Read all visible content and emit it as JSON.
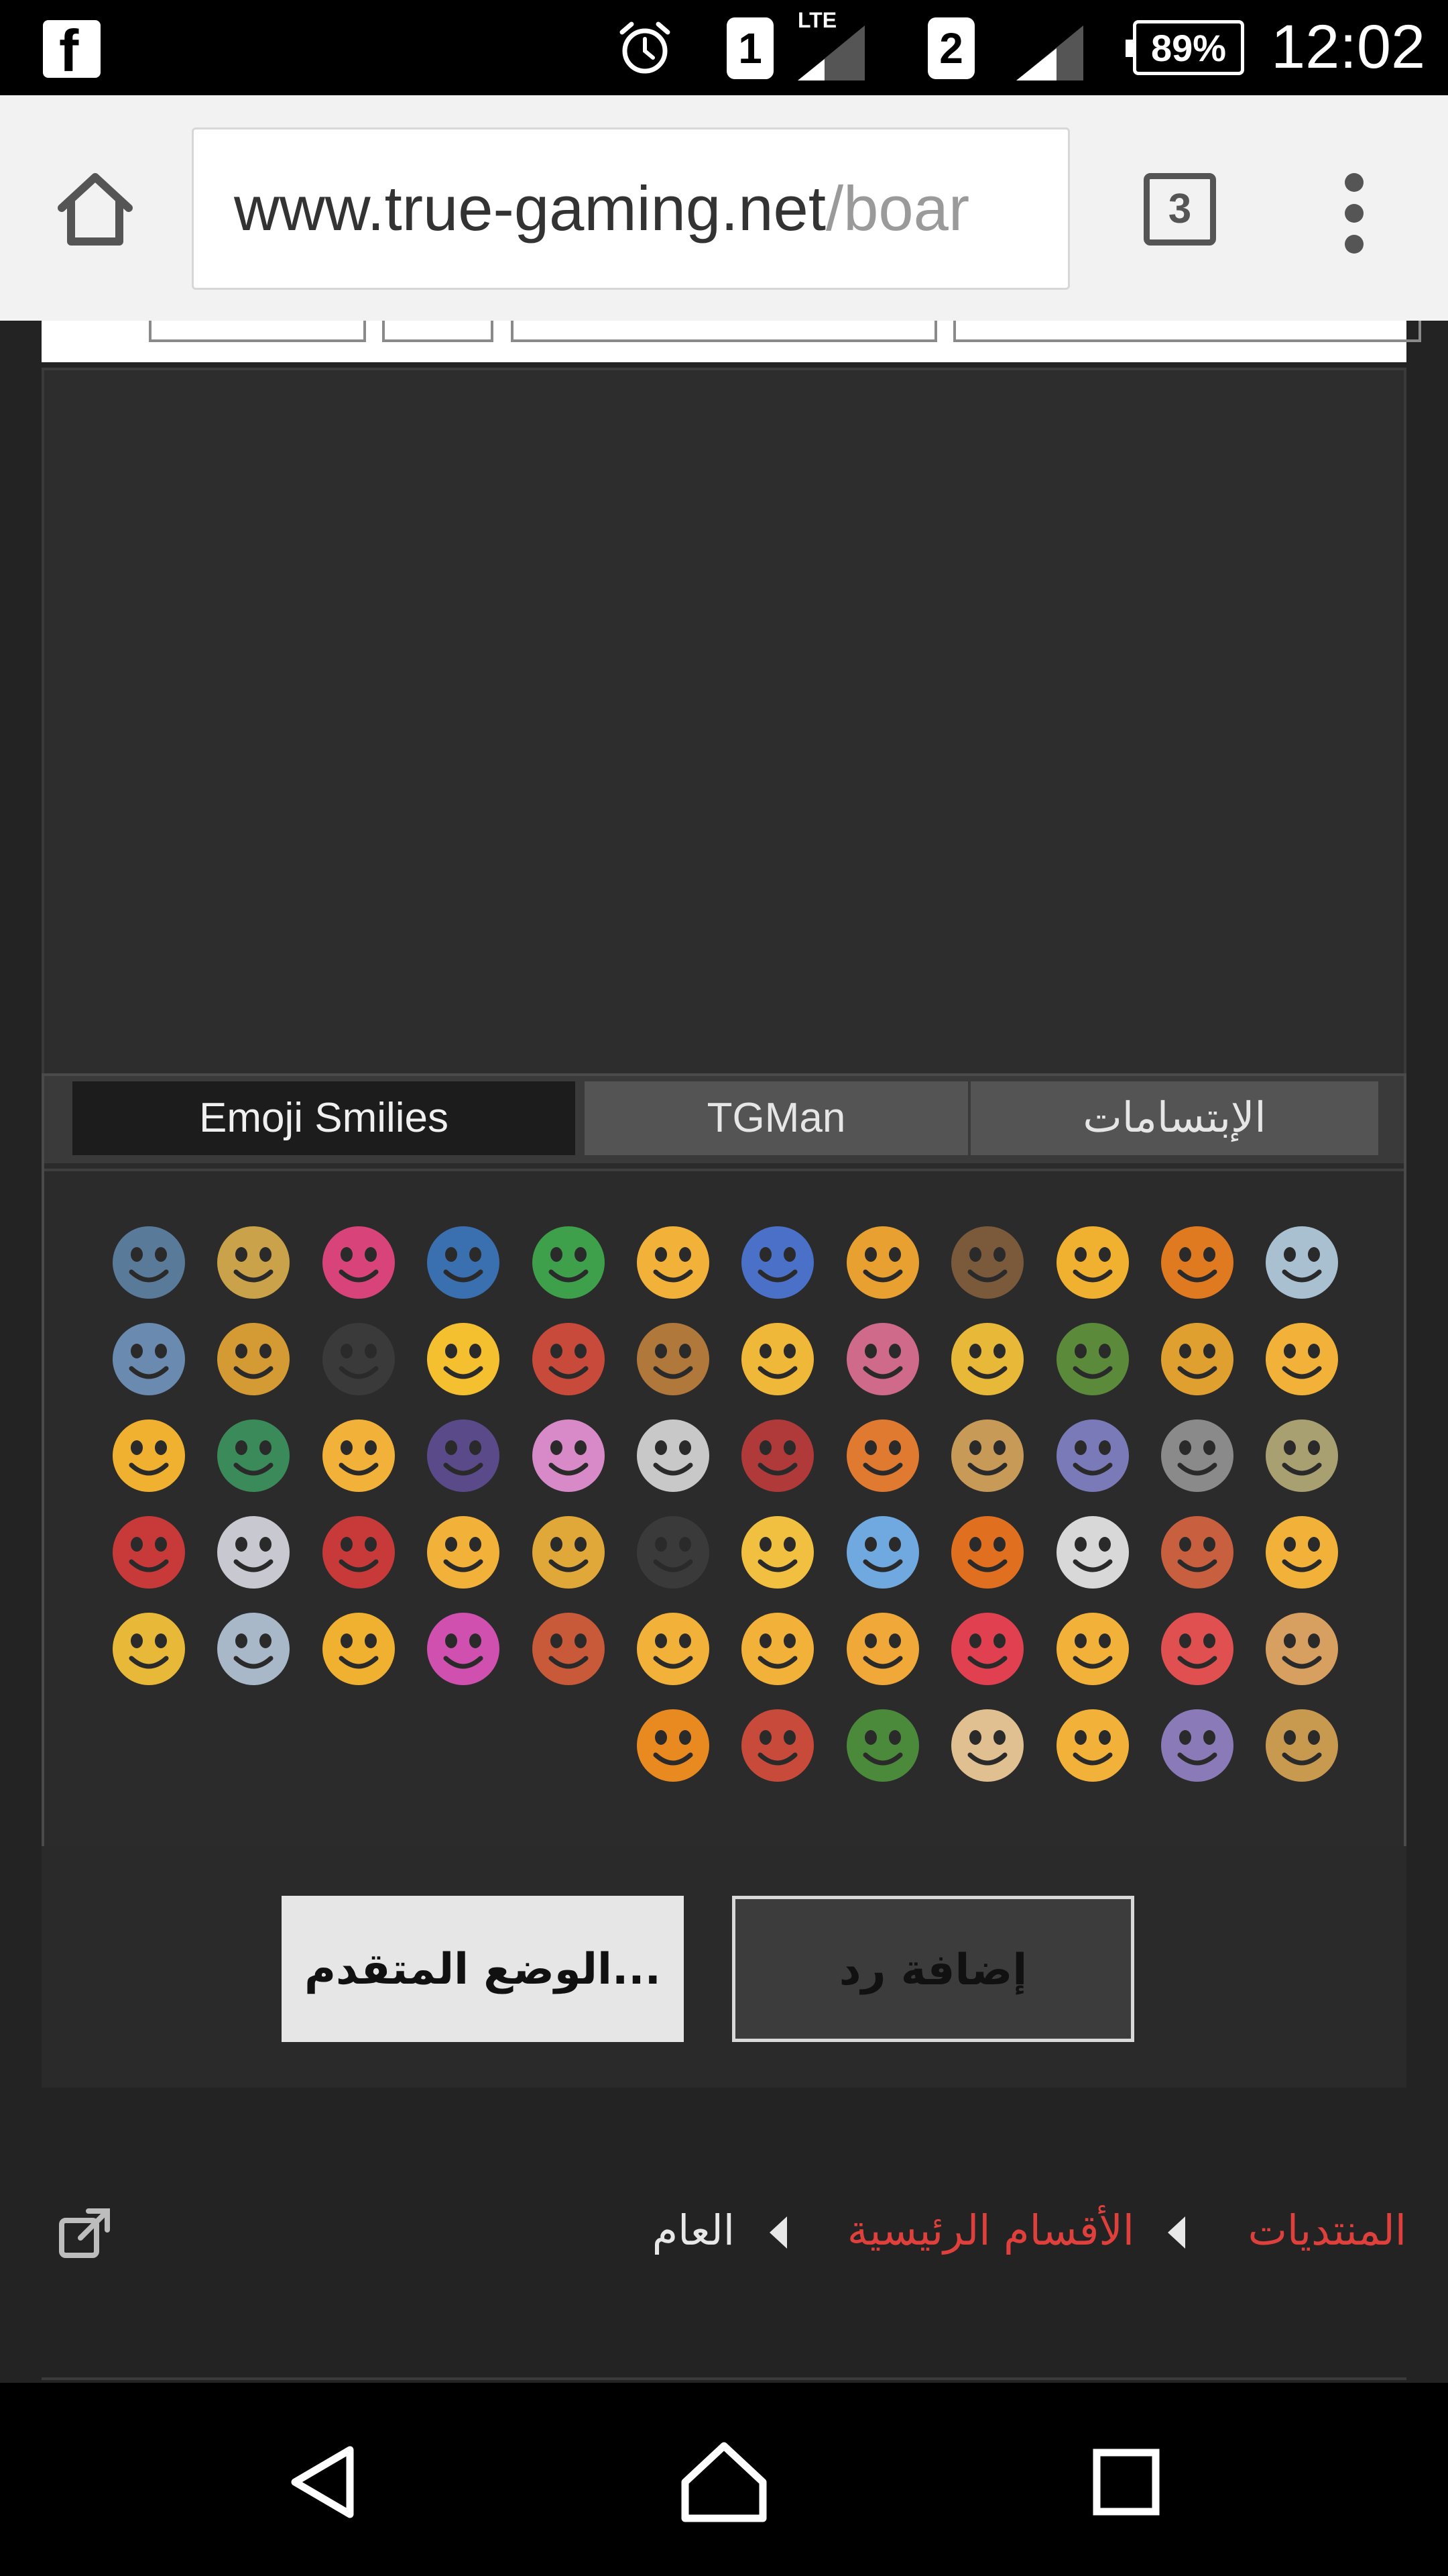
{
  "status_bar": {
    "sim1": "1",
    "sim2": "2",
    "network": "LTE",
    "battery": "89%",
    "time": "12:02",
    "icons": [
      "facebook-icon",
      "alarm-icon",
      "signal-icon",
      "battery-icon"
    ]
  },
  "browser": {
    "url_host": "www.true-gaming.net",
    "url_path": "/boar",
    "tab_count": "3",
    "icons": [
      "home-icon",
      "tabs-icon",
      "more-vert-icon"
    ]
  },
  "smilies": {
    "tabs": [
      {
        "label": "Emoji Smilies",
        "active": true
      },
      {
        "label": "TGMan",
        "active": false
      },
      {
        "label": "الإبتسامات",
        "active": false
      }
    ],
    "rows": [
      [
        "#5a7a9a",
        "#c9a24a",
        "#d8447a",
        "#3a6fb0",
        "#3ea04a",
        "#f2b23a",
        "#4a70c8",
        "#e8a030",
        "#7a5a3a",
        "#f0b030",
        "#e07a20",
        "#a8c0d0"
      ],
      [
        "#6a8ab0",
        "#d49a34",
        "#3a3a3a",
        "#f4c030",
        "#c84a3a",
        "#b0783a",
        "#f0b838",
        "#d06a8a",
        "#e8b838",
        "#5a8a3a",
        "#e0a030",
        "#f2b23a"
      ],
      [
        "#f0b030",
        "#3a8a5a",
        "#f2b23a",
        "#5a4a8a",
        "#d88ac8",
        "#c8c8c8",
        "#b03a3a",
        "#e07a30",
        "#c89a58",
        "#7a7ab8",
        "#8a8a8a",
        "#a8a070"
      ],
      [
        "#c83a3a",
        "#c8c8d0",
        "#c83a3a",
        "#f2b23a",
        "#e0a838",
        "#3a3a3a",
        "#f2c040",
        "#70a8e0",
        "#e07020",
        "#d8d8d8",
        "#c86040",
        "#f2b23a"
      ],
      [
        "#e8b838",
        "#a8b8c8",
        "#f0b030",
        "#d050b0",
        "#c85a3a",
        "#f2b23a",
        "#f2b23a",
        "#f0a838",
        "#e04050",
        "#f2b23a",
        "#e05050",
        "#d8a060"
      ],
      [
        null,
        null,
        null,
        null,
        null,
        "#e88a20",
        "#c84a3a",
        "#4a8a3a",
        "#e0c090",
        "#f2b23a",
        "#8a7ab8",
        "#c89a50"
      ]
    ]
  },
  "reply": {
    "advanced_label": "الوضع المتقدم...",
    "reply_label": "إضافة رد"
  },
  "breadcrumb": {
    "items": [
      "المنتديات",
      "الأقسام الرئيسية",
      "العام"
    ],
    "icons": [
      "external-link-icon"
    ]
  },
  "nav_bar": {
    "icons": [
      "back-icon",
      "home-icon",
      "recents-icon"
    ]
  }
}
